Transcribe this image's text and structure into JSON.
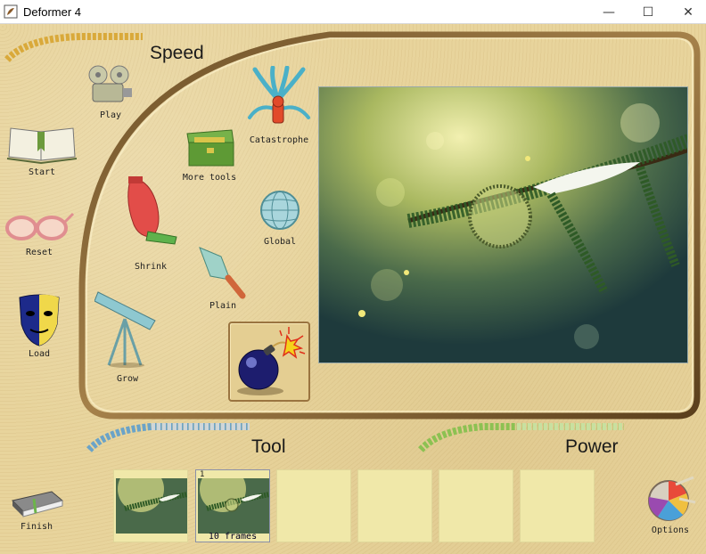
{
  "window": {
    "title": "Deformer 4",
    "minimize": "—",
    "maximize": "☐",
    "close": "✕"
  },
  "headings": {
    "speed": "Speed",
    "tool": "Tool",
    "power": "Power"
  },
  "tools": {
    "play": "Play",
    "start": "Start",
    "reset": "Reset",
    "load": "Load",
    "grow": "Grow",
    "shrink": "Shrink",
    "more_tools": "More tools",
    "plain": "Plain",
    "catastrophe": "Catastrophe",
    "global": "Global",
    "finish": "Finish",
    "options": "Options"
  },
  "frames": {
    "selected_number": "1",
    "count_label": "10 frames"
  },
  "colors": {
    "sand": "#e8d49c",
    "frame_brown": "#8c6a3c",
    "thumb_bg": "#f0e8a9",
    "speed_stair": "#d9a93a",
    "tool_stair": "#6aa3c8",
    "power_stair": "#8cc152"
  }
}
